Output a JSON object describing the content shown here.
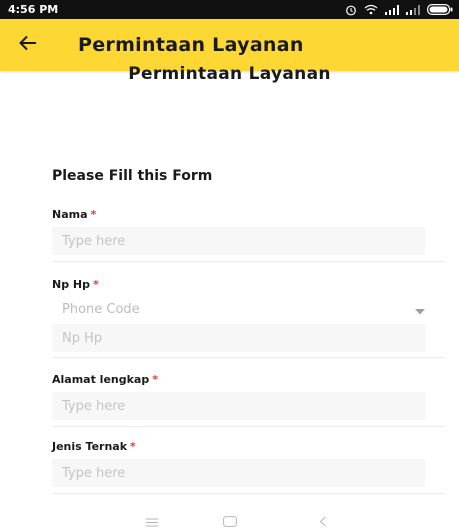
{
  "status_bar": {
    "time": "4:56 PM",
    "icons": [
      "alarm-icon",
      "wifi-icon",
      "signal-icon",
      "signal-icon",
      "battery-icon"
    ]
  },
  "app_bar": {
    "title": "Permintaan Layanan",
    "back_icon": "arrow-left-icon",
    "color": "#FDD835"
  },
  "page": {
    "title": "Permintaan Layanan",
    "form_heading": "Please Fill this Form"
  },
  "form": {
    "nama": {
      "label": "Nama",
      "required": "*",
      "placeholder": "Type here"
    },
    "np_hp": {
      "label": "Np Hp",
      "required": "*",
      "phone_code_value": "Phone Code",
      "placeholder": "Np Hp"
    },
    "alamat": {
      "label": "Alamat lengkap",
      "required": "*",
      "placeholder": "Type here"
    },
    "jenis_ternak": {
      "label": "Jenis Ternak",
      "required": "*",
      "placeholder": "Type here"
    }
  },
  "nav_bar": {
    "icons": [
      "menu-icon",
      "home-square-icon",
      "back-chevron-icon"
    ]
  },
  "colors": {
    "accent": "#FDD835",
    "required": "#e53935",
    "input_bg": "#f7f7f7"
  }
}
